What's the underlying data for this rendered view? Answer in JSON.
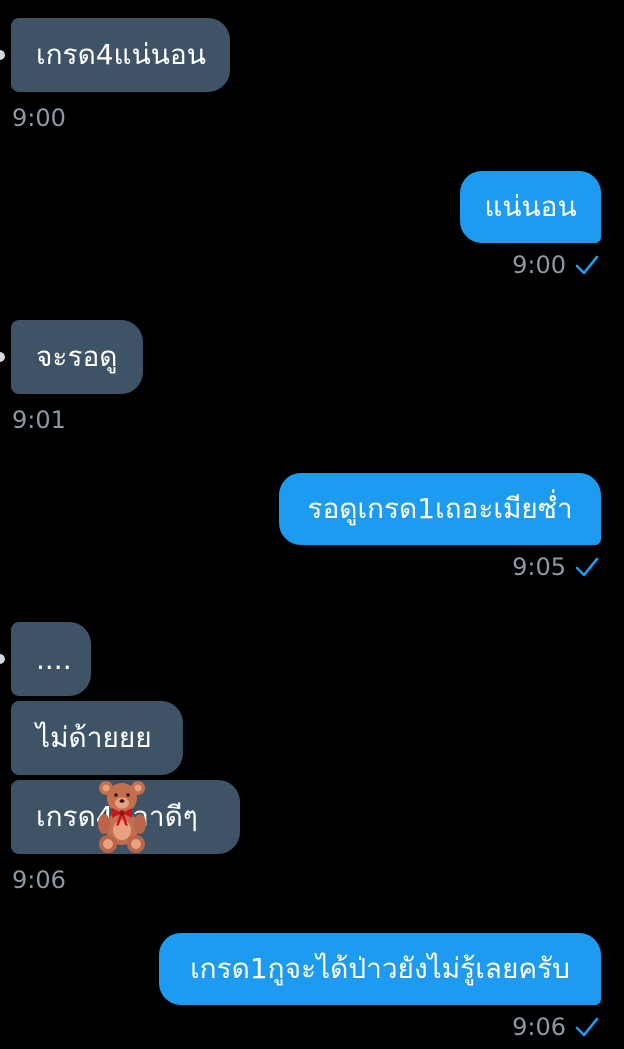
{
  "messages": [
    {
      "direction": "in",
      "text": "เกรด4แน่นอน",
      "time": "9:00"
    },
    {
      "direction": "out",
      "text": "แน่นอน",
      "time": "9:00",
      "status": "sent-check-icon"
    },
    {
      "direction": "in",
      "text": "จะรอดู",
      "time": "9:01"
    },
    {
      "direction": "out",
      "text": "รอดูเกรด1เถอะเมียซ่ำ",
      "time": "9:05",
      "status": "sent-check-icon"
    },
    {
      "direction": "in",
      "text": "....",
      "time": ""
    },
    {
      "direction": "in",
      "text": "ไม่ด้ายยย",
      "time": ""
    },
    {
      "direction": "in",
      "text": "เกรด4 เอาดีๆ",
      "time": "9:06",
      "sticker": "teddy-bear-icon"
    },
    {
      "direction": "out",
      "text": "เกรด1กูจะได้ป่าวยังไม่รู้เลยครับ",
      "time": "9:06",
      "status": "sent-check-icon"
    }
  ],
  "colors": {
    "background": "#000000",
    "incoming_bubble": "#3e5366",
    "outgoing_bubble": "#1d9bf0",
    "timestamp": "#8b98a5",
    "check": "#1d9bf0"
  }
}
